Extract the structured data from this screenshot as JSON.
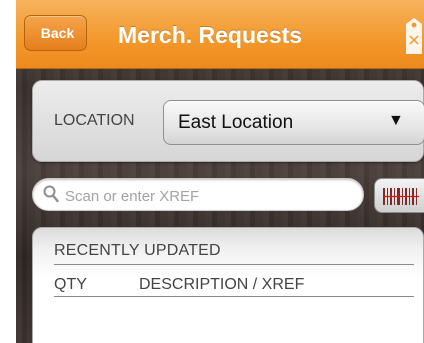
{
  "header": {
    "back_label": "Back",
    "title": "Merch. Requests",
    "tag_icon": "price-tag-icon",
    "accent_color": "#f39a2f"
  },
  "location": {
    "label": "LOCATION",
    "selected": "East Location",
    "dropdown_icon": "triangle-down"
  },
  "search": {
    "placeholder": "Scan or enter XREF",
    "value": "",
    "icon": "search-icon",
    "barcode_icon": "barcode-icon"
  },
  "recent": {
    "title": "RECENTLY UPDATED",
    "columns": [
      "QTY",
      "DESCRIPTION / XREF"
    ],
    "rows": []
  }
}
